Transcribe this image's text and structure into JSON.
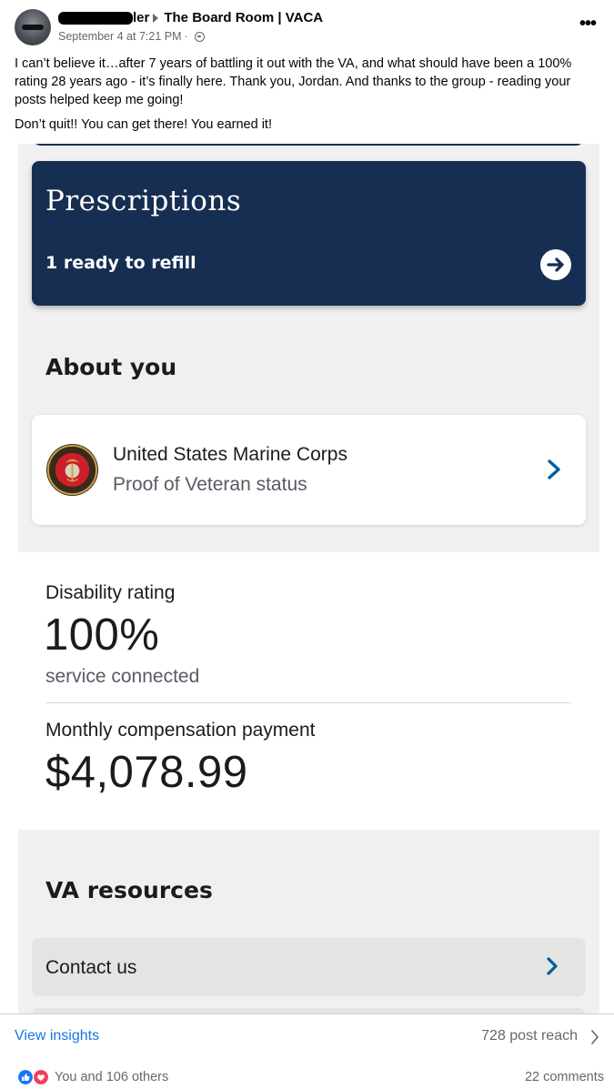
{
  "post": {
    "author_suffix": "ler",
    "group": "The Board Room | VACA",
    "timestamp": "September 4 at 7:21 PM",
    "dot_separator": "·",
    "body": "I can’t believe it…after 7 years of battling it out with the VA, and what should have been a 100% rating 28 years ago - it’s finally here. Thank you, Jordan. And thanks to the group - reading your posts helped keep me going!",
    "body2": "Don’t quit!!  You can get there!  You earned it!",
    "more_icon": "•••"
  },
  "app": {
    "prescriptions": {
      "title": "Prescriptions",
      "subtitle": "1 ready to refill"
    },
    "about": {
      "heading": "About you",
      "branch": "United States Marine Corps",
      "status": "Proof of Veteran status"
    },
    "rating": {
      "label": "Disability rating",
      "value": "100%",
      "sub": "service connected",
      "comp_label": "Monthly compensation payment",
      "comp_value": "$4,078.99"
    },
    "resources": {
      "heading": "VA resources",
      "contact": "Contact us"
    },
    "colors": {
      "navy": "#162e51",
      "link_blue": "#005ea2",
      "panel_bg": "#f0f0f0"
    }
  },
  "footer": {
    "view_insights": "View insights",
    "reach": "728 post reach",
    "reactions": "You and 106 others",
    "comments": "22 comments"
  }
}
